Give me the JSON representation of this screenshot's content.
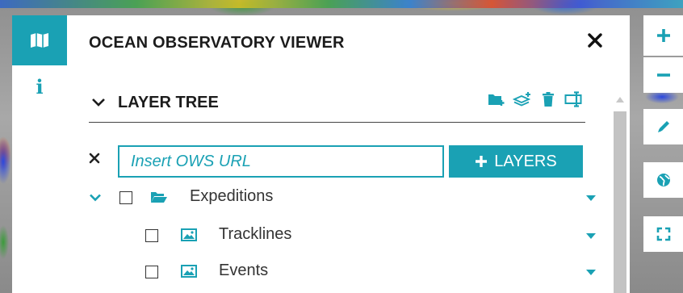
{
  "panel": {
    "title": "OCEAN OBSERVATORY VIEWER",
    "close_label": "✕"
  },
  "layer_tree": {
    "title": "LAYER TREE",
    "tools": [
      "add-folder-icon",
      "add-layer-icon",
      "trash-icon",
      "rename-icon"
    ]
  },
  "ows": {
    "clear_label": "✕",
    "placeholder": "Insert OWS URL",
    "value": "",
    "button_label": "LAYERS"
  },
  "tree": {
    "root": {
      "label": "Expeditions",
      "expanded": true,
      "checked": false
    },
    "children": [
      {
        "label": "Tracklines",
        "checked": false
      },
      {
        "label": "Events",
        "checked": false
      }
    ]
  },
  "rail": {
    "items": [
      "map-icon",
      "info-icon"
    ],
    "info_glyph": "i"
  },
  "map_controls": [
    "zoom-in-icon",
    "zoom-out-icon",
    "pencil-icon",
    "globe-icon",
    "fullscreen-icon"
  ],
  "colors": {
    "accent": "#1aa1b4",
    "text": "#1c1c1c"
  }
}
